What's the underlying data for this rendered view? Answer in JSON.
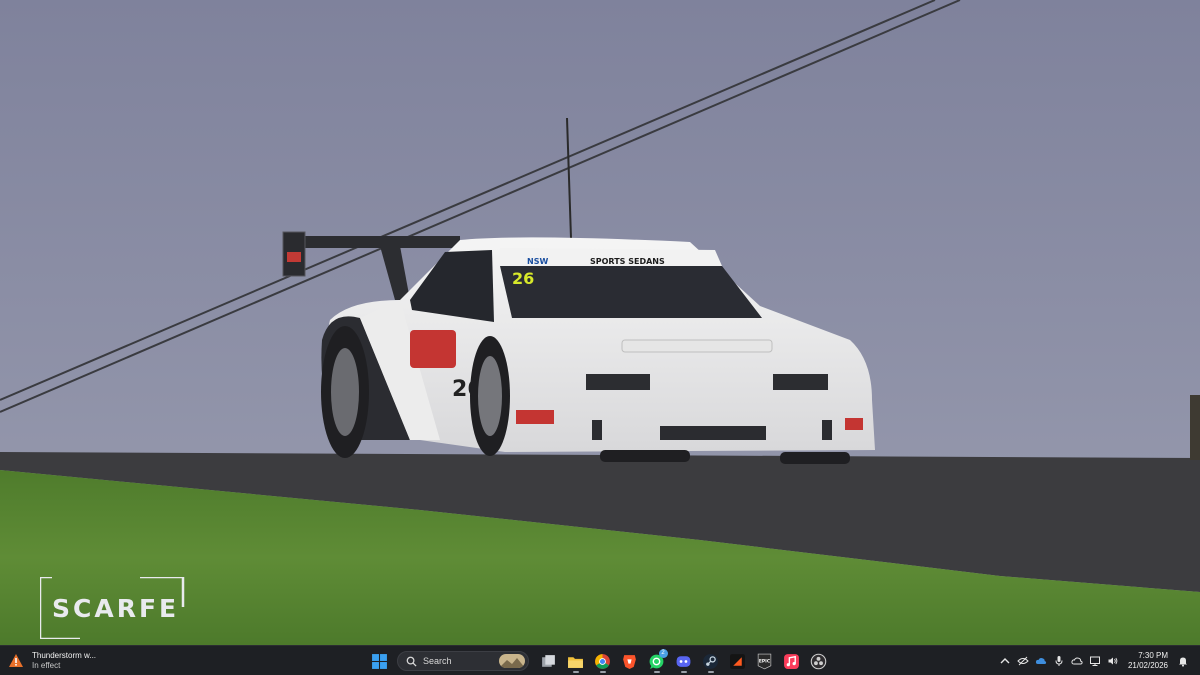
{
  "wallpaper": {
    "description_colors": {
      "sky": "#8b8ea6",
      "track": "#3b3b3d",
      "grass": "#4e7a2e",
      "car_body": "#eeeeee"
    },
    "car": {
      "number": "26",
      "banner": "SPORTS SEDANS",
      "banner_prefix": "NSW"
    }
  },
  "watermark": {
    "text": "SCARFE"
  },
  "taskbar": {
    "weather": {
      "icon": "warning-triangle-icon",
      "title": "Thunderstorm w...",
      "subtitle": "In effect"
    },
    "start_icon": "windows-logo-icon",
    "search": {
      "placeholder": "Search"
    },
    "apps": [
      {
        "name": "task-view-icon"
      },
      {
        "name": "file-explorer-icon"
      },
      {
        "name": "chrome-icon"
      },
      {
        "name": "brave-icon"
      },
      {
        "name": "whatsapp-icon",
        "badge": "2"
      },
      {
        "name": "discord-icon"
      },
      {
        "name": "steam-icon"
      },
      {
        "name": "flag-app-icon"
      },
      {
        "name": "epic-games-icon"
      },
      {
        "name": "apple-music-icon"
      },
      {
        "name": "obs-icon"
      }
    ],
    "epic_label": "EPIC",
    "tray": {
      "clock_time": "7:30 PM",
      "clock_date": "21/02/2026"
    }
  }
}
